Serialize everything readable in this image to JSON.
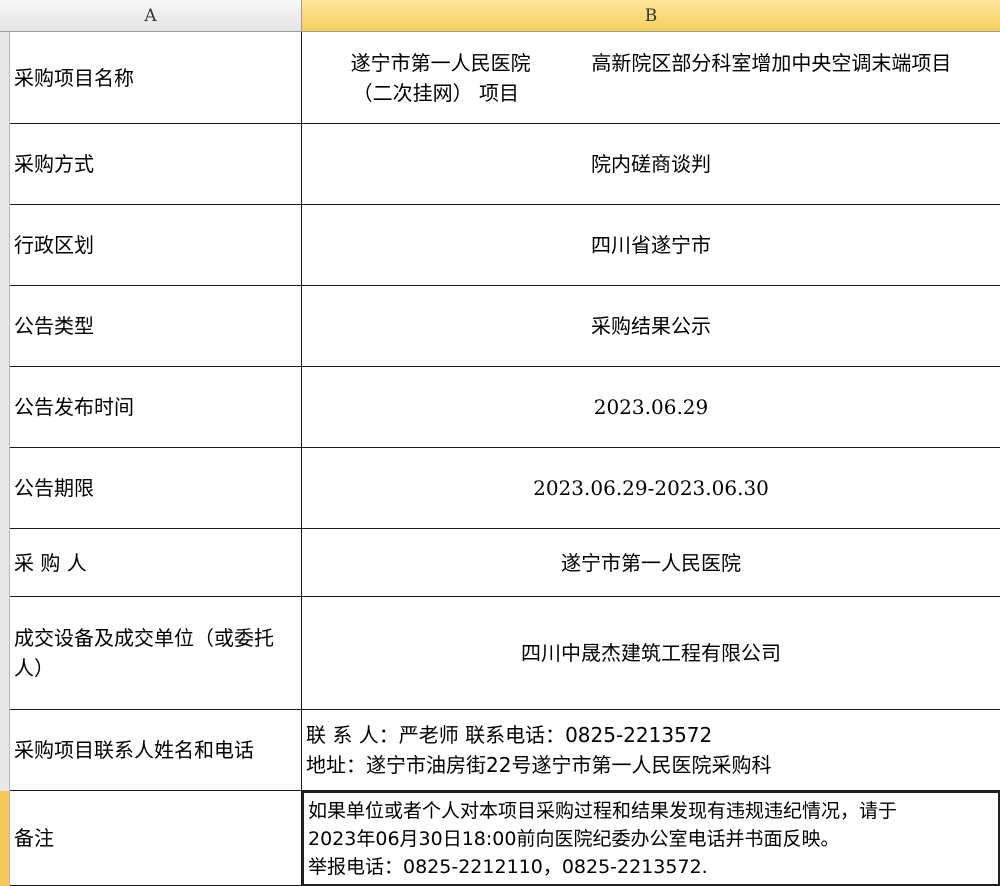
{
  "columns": {
    "a": "A",
    "b": "B"
  },
  "rows": {
    "project_name": {
      "label": "采购项目名称",
      "line1_left": "遂宁市第一人民医院",
      "line1_right": "高新院区部分科室增加中央空调末端项目",
      "line2": "（二次挂网） 项目"
    },
    "method": {
      "label": "采购方式",
      "value": "院内磋商谈判"
    },
    "region": {
      "label": "行政区划",
      "value": "四川省遂宁市"
    },
    "notice_type": {
      "label": "公告类型",
      "value": "采购结果公示"
    },
    "publish_time": {
      "label": "公告发布时间",
      "value": "2023.06.29"
    },
    "period": {
      "label": "公告期限",
      "value": "2023.06.29-2023.06.30"
    },
    "purchaser": {
      "label": "采 购 人",
      "value": "遂宁市第一人民医院"
    },
    "winner": {
      "label": "成交设备及成交单位（或委托人）",
      "value": "四川中晟杰建筑工程有限公司"
    },
    "contact": {
      "label": "采购项目联系人姓名和电话",
      "line1": "联 系 人：严老师 联系电话：0825-2213572",
      "line2": "地址：遂宁市油房街22号遂宁市第一人民医院采购科"
    },
    "remark": {
      "label": "备注",
      "line1": "如果单位或者个人对本项目采购过程和结果发现有违规违纪情况，请于",
      "line2": "2023年06月30日18:00前向医院纪委办公室电话并书面反映。",
      "line3": "举报电话：0825-2212110，0825-2213572."
    }
  }
}
